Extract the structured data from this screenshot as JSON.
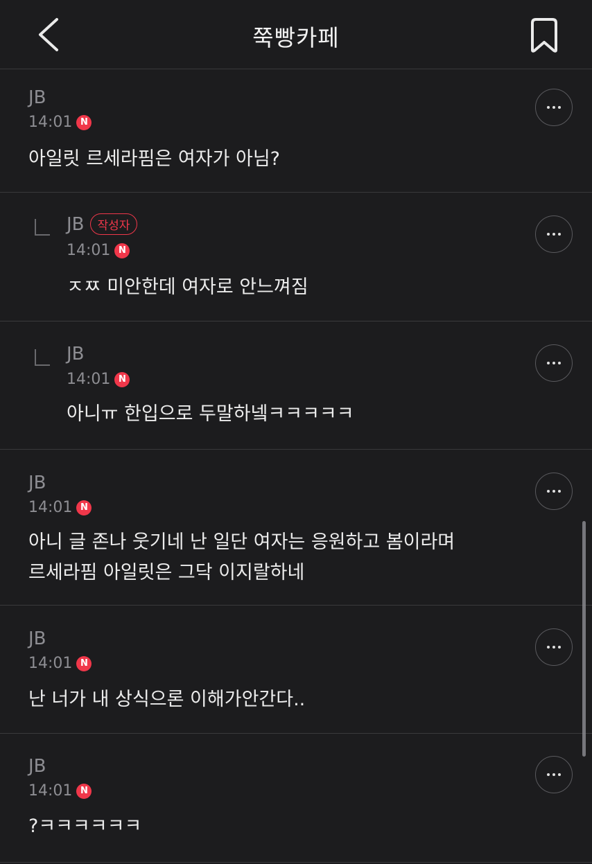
{
  "header": {
    "title": "쭉빵카페"
  },
  "writer_badge": "작성자",
  "new_badge": "N",
  "comments": [
    {
      "author": "JB",
      "time": "14:01",
      "body": [
        "아일릿 르세라핌은 여자가 아님?"
      ]
    },
    {
      "author": "JB",
      "time": "14:01",
      "body": [
        "ㅈㅉ 미안한데 여자로 안느껴짐"
      ],
      "reply": true,
      "is_writer": true
    },
    {
      "author": "JB",
      "time": "14:01",
      "body": [
        "아니ㅠ 한입으로 두말하넼ㅋㅋㅋㅋㅋ"
      ],
      "reply": true
    },
    {
      "author": "JB",
      "time": "14:01",
      "body": [
        "아니 글 존나 웃기네 난 일단 여자는 응원하고 봄이라며",
        "르세라핌 아일릿은 그닥 이지랄하네"
      ]
    },
    {
      "author": "JB",
      "time": "14:01",
      "body": [
        "난 너가 내 상식으론 이해가안간다.."
      ]
    },
    {
      "author": "JB",
      "time": "14:01",
      "body": [
        "?ㅋㅋㅋㅋㅋㅋ"
      ]
    }
  ]
}
